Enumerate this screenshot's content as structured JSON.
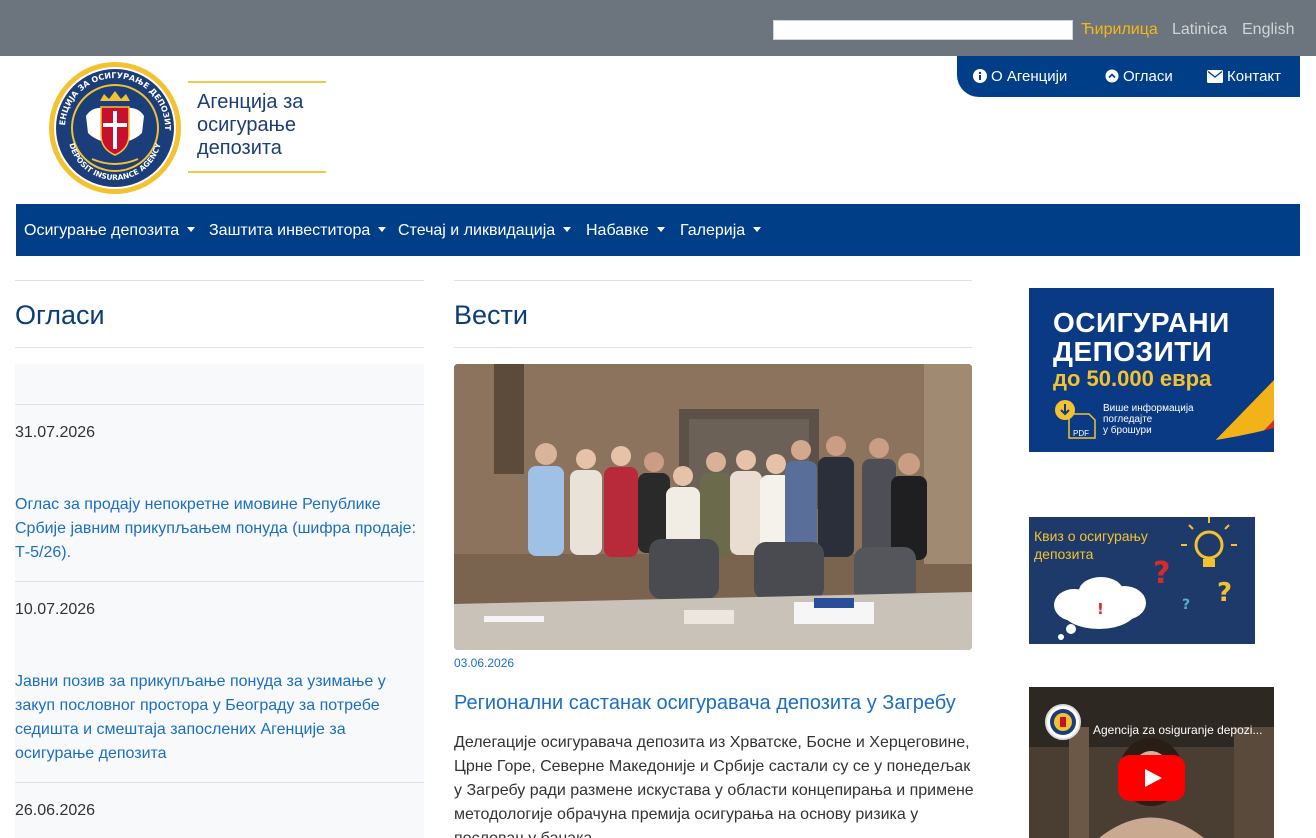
{
  "top_bar": {
    "search_placeholder": "",
    "languages": [
      {
        "label": "Ћирилица",
        "active": true
      },
      {
        "label": "Latinica",
        "active": false
      },
      {
        "label": "English",
        "active": false
      }
    ]
  },
  "logo": {
    "text_line1": "Агенција за",
    "text_line2": "осигурање",
    "text_line3": "депозита",
    "seal_text_top": "АГЕНЦИЈА ЗА ОСИГУРАЊЕ ДЕПОЗИТА",
    "seal_text_bottom": "DEPOSIT INSURANCE AGENCY"
  },
  "utility_nav": [
    {
      "label": "О Агенцији",
      "icon": "info-icon"
    },
    {
      "label": "Огласи",
      "icon": "circle-chevron-icon"
    },
    {
      "label": "Контакт",
      "icon": "envelope-icon"
    }
  ],
  "main_nav": [
    {
      "label": "Осигурање депозита"
    },
    {
      "label": "Заштита инвеститора"
    },
    {
      "label": "Стечај и ликвидација"
    },
    {
      "label": "Набавке"
    },
    {
      "label": "Галерија"
    }
  ],
  "notices": {
    "title": "Огласи",
    "items": [
      {
        "date": "31.07.2026",
        "text": "Оглас за продају непокретне имовине Републике Србије јавним прикупљањем понуда (шифра продаје: Т-5/26)."
      },
      {
        "date": "10.07.2026",
        "text": "Јавни позив за прикупљање понуда за узимање у закуп пословног простора у Београду за потребе седишта и смештаја запослених Агенције за осигурање депозита"
      },
      {
        "date": "26.06.2026",
        "text": ""
      }
    ]
  },
  "news": {
    "title": "Вести",
    "date": "03.06.2026",
    "headline": "Регионални састанак осигуравача депозита у Загребу",
    "body": "Делегације осигуравача депозита из Хрватске, Босне и Херцеговине, Црне Горе, Северне Македоније и Србије састали су се у понедељак у Загребу ради размене искустава у области концепирања и примене методологије обрачуна премија осигурања на основу ризика у пословању банака."
  },
  "sidebar": {
    "banner1": {
      "line1": "ОСИГУРАНИ",
      "line2": "ДЕПОЗИТИ",
      "amount": "до 50.000 евра",
      "info1": "Више информација",
      "info2": "погледајте",
      "info3": "у брошури",
      "pdf_label": "PDF"
    },
    "banner2": {
      "line1": "Квиз о осигурању",
      "line2": "депозита"
    },
    "video": {
      "title": "Agencija za osiguranje depozi..."
    }
  },
  "colors": {
    "top_bar": "#6c757d",
    "nav_blue": "#003f88",
    "link_blue": "#1b6ec2",
    "active_lang": "#f7b718"
  }
}
